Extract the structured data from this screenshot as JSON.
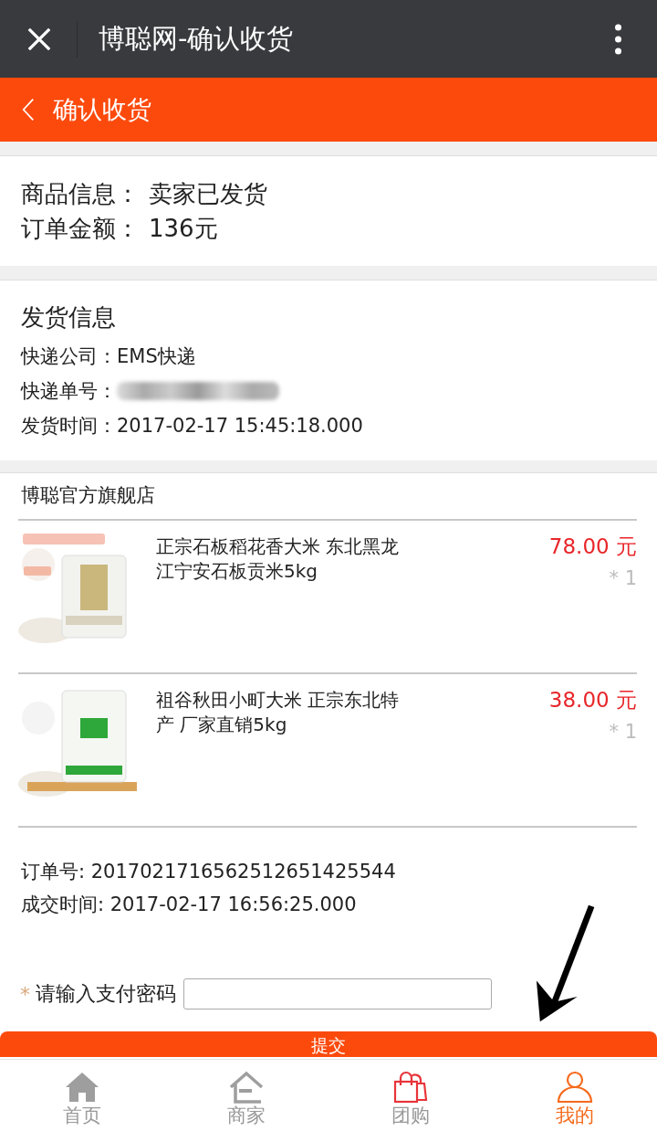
{
  "window": {
    "title": "博聪网-确认收货"
  },
  "header": {
    "title": "确认收货"
  },
  "order_summary": [
    {
      "label": "商品信息：",
      "value": "卖家已发货"
    },
    {
      "label": "订单金额：",
      "value": "136元"
    }
  ],
  "shipping": {
    "title": "发货信息",
    "rows": [
      {
        "label": "快递公司：",
        "value": "EMS快递",
        "kind": "text"
      },
      {
        "label": "快递单号：",
        "kind": "redacted"
      },
      {
        "label": "发货时间：",
        "value": "2017-02-17 15:45:18.000",
        "kind": "text"
      }
    ]
  },
  "store": {
    "name": "博聪官方旗舰店"
  },
  "products": [
    {
      "title": "正宗石板稻花香大米 东北黑龙江宁安石板贡米5kg",
      "price": "78.00 元",
      "quantity": "* 1",
      "kind": "picture"
    },
    {
      "title": "祖谷秋田小町大米 正宗东北特产 厂家直销5kg",
      "price": "38.00 元",
      "quantity": "* 1",
      "kind": "picture"
    }
  ],
  "order_info": [
    {
      "label": "订单号: ",
      "value": "2017021716562512651425544"
    },
    {
      "label": "成交时间: ",
      "value": "2017-02-17 16:56:25.000"
    }
  ],
  "password": {
    "required_mark": "*",
    "label": "请输入支付密码"
  },
  "submit_button": "提交",
  "nav": [
    {
      "label": "首页",
      "selected": false
    },
    {
      "label": "商家",
      "selected": false
    },
    {
      "label": "团购",
      "selected": false
    },
    {
      "label": "我的",
      "selected": true
    }
  ]
}
